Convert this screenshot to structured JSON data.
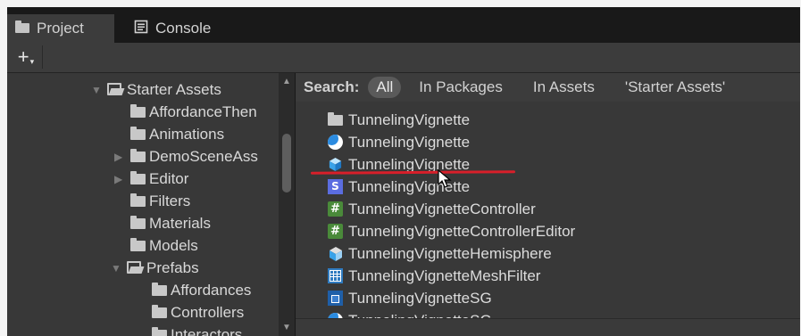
{
  "tabs": [
    {
      "label": "Project",
      "icon": "folder-icon"
    },
    {
      "label": "Console",
      "icon": "console-icon"
    }
  ],
  "toolbar": {
    "add_label": "+"
  },
  "tree": {
    "items": [
      {
        "label": "Starter Assets",
        "expanded": true,
        "arrow": "▼"
      },
      {
        "label": "AffordanceThen"
      },
      {
        "label": "Animations"
      },
      {
        "label": "DemoSceneAss",
        "arrow": "▶"
      },
      {
        "label": "Editor",
        "arrow": "▶"
      },
      {
        "label": "Filters"
      },
      {
        "label": "Materials"
      },
      {
        "label": "Models"
      },
      {
        "label": "Prefabs",
        "expanded": true,
        "arrow": "▼"
      },
      {
        "label": "Affordances"
      },
      {
        "label": "Controllers"
      },
      {
        "label": "Interactors"
      }
    ]
  },
  "search": {
    "label": "Search:",
    "all": "All",
    "in_packages": "In Packages",
    "in_assets": "In Assets",
    "folder_scope": "'Starter Assets'"
  },
  "results": [
    {
      "label": "TunnelingVignette",
      "icon": "folder-icon"
    },
    {
      "label": "TunnelingVignette",
      "icon": "material-icon"
    },
    {
      "label": "TunnelingVignette",
      "icon": "prefab-cube-icon"
    },
    {
      "label": "TunnelingVignette",
      "icon": "shader-icon"
    },
    {
      "label": "TunnelingVignetteController",
      "icon": "script-icon"
    },
    {
      "label": "TunnelingVignetteControllerEditor",
      "icon": "script-icon"
    },
    {
      "label": "TunnelingVignetteHemisphere",
      "icon": "model-icon"
    },
    {
      "label": "TunnelingVignetteMeshFilter",
      "icon": "mesh-icon"
    },
    {
      "label": "TunnelingVignetteSG",
      "icon": "shader-graph-icon"
    },
    {
      "label": "TunnelingVignetteSG",
      "icon": "material-icon"
    }
  ],
  "colors": {
    "annotation": "#d81f2a",
    "panel": "#383838",
    "tab_active": "#3c3c3c"
  }
}
